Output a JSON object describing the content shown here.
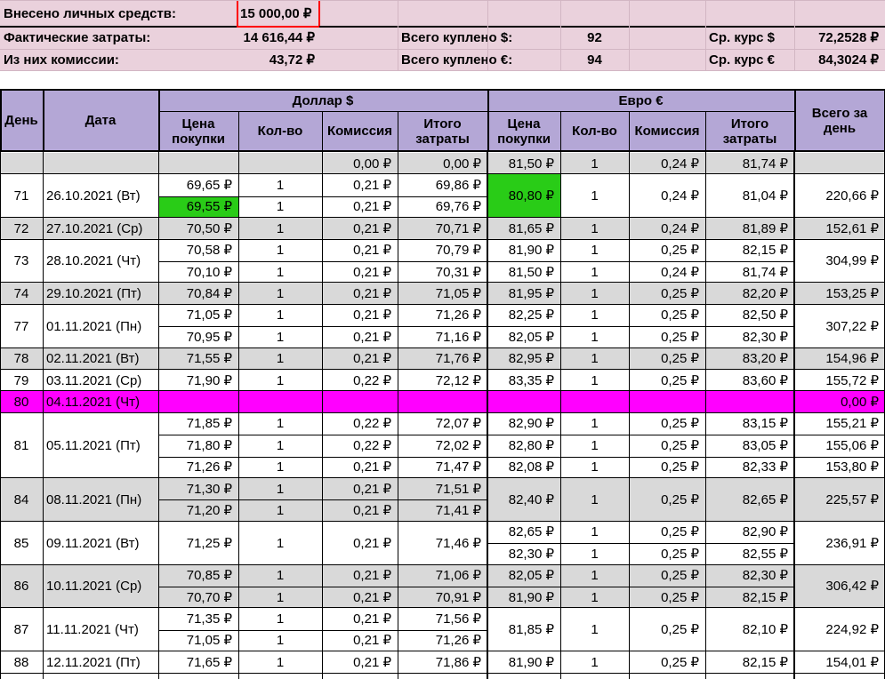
{
  "colors": {
    "summary_bg": "#ead1dc",
    "header_bg": "#b4a7d6",
    "gray_row": "#d9d9d9",
    "holiday": "#ff00ff",
    "highlight_green": "#29cc17",
    "accent_red": "#ff0000"
  },
  "summary": {
    "deposited_label": "Внесено личных средств:",
    "deposited_value": "15 000,00 ₽",
    "actual_label": "Фактические затраты:",
    "actual_value": "14 616,44 ₽",
    "commission_label": "Из них комиссии:",
    "commission_value": "43,72 ₽",
    "usd_bought_label": "Всего куплено $:",
    "usd_bought_value": "92",
    "eur_bought_label": "Всего куплено €:",
    "eur_bought_value": "94",
    "usd_rate_label": "Ср. курс $",
    "usd_rate_value": "72,2528 ₽",
    "eur_rate_label": "Ср. курс €",
    "eur_rate_value": "84,3024 ₽"
  },
  "header": {
    "day": "День",
    "date": "Дата",
    "usd_group": "Доллар $",
    "eur_group": "Евро €",
    "price": "Цена покупки",
    "qty": "Кол-во",
    "commission": "Комиссия",
    "total": "Итого затраты",
    "day_total": "Всего за день"
  },
  "groups": [
    {
      "day": "",
      "date": "",
      "total": "",
      "bg": "gray",
      "rows": 1,
      "usd": [
        {
          "price": "",
          "qty": "",
          "com": "0,00 ₽",
          "tot": "0,00 ₽"
        }
      ],
      "eur": [
        {
          "price": "81,50 ₽",
          "qty": "1",
          "com": "0,24 ₽",
          "tot": "81,74 ₽"
        }
      ]
    },
    {
      "day": "71",
      "date": "26.10.2021 (Вт)",
      "total": "220,66 ₽",
      "bg": "white",
      "rows": 2,
      "usd": [
        {
          "price": "69,65 ₽",
          "qty": "1",
          "com": "0,21 ₽",
          "tot": "69,86 ₽"
        },
        {
          "price": "69,55 ₽",
          "qty": "1",
          "com": "0,21 ₽",
          "tot": "69,76 ₽",
          "green": true
        }
      ],
      "eur": [
        {
          "price": "80,80 ₽",
          "qty": "1",
          "com": "0,24 ₽",
          "tot": "81,04 ₽",
          "green": true
        }
      ]
    },
    {
      "day": "72",
      "date": "27.10.2021 (Ср)",
      "total": "152,61 ₽",
      "bg": "gray",
      "rows": 1,
      "usd": [
        {
          "price": "70,50 ₽",
          "qty": "1",
          "com": "0,21 ₽",
          "tot": "70,71 ₽"
        }
      ],
      "eur": [
        {
          "price": "81,65 ₽",
          "qty": "1",
          "com": "0,24 ₽",
          "tot": "81,89 ₽"
        }
      ]
    },
    {
      "day": "73",
      "date": "28.10.2021 (Чт)",
      "total": "304,99 ₽",
      "bg": "white",
      "rows": 2,
      "usd": [
        {
          "price": "70,58 ₽",
          "qty": "1",
          "com": "0,21 ₽",
          "tot": "70,79 ₽"
        },
        {
          "price": "70,10 ₽",
          "qty": "1",
          "com": "0,21 ₽",
          "tot": "70,31 ₽"
        }
      ],
      "eur": [
        {
          "price": "81,90 ₽",
          "qty": "1",
          "com": "0,25 ₽",
          "tot": "82,15 ₽"
        },
        {
          "price": "81,50 ₽",
          "qty": "1",
          "com": "0,24 ₽",
          "tot": "81,74 ₽"
        }
      ]
    },
    {
      "day": "74",
      "date": "29.10.2021 (Пт)",
      "total": "153,25 ₽",
      "bg": "gray",
      "rows": 1,
      "usd": [
        {
          "price": "70,84 ₽",
          "qty": "1",
          "com": "0,21 ₽",
          "tot": "71,05 ₽"
        }
      ],
      "eur": [
        {
          "price": "81,95 ₽",
          "qty": "1",
          "com": "0,25 ₽",
          "tot": "82,20 ₽"
        }
      ]
    },
    {
      "day": "77",
      "date": "01.11.2021 (Пн)",
      "total": "307,22 ₽",
      "bg": "white",
      "rows": 2,
      "usd": [
        {
          "price": "71,05 ₽",
          "qty": "1",
          "com": "0,21 ₽",
          "tot": "71,26 ₽"
        },
        {
          "price": "70,95 ₽",
          "qty": "1",
          "com": "0,21 ₽",
          "tot": "71,16 ₽"
        }
      ],
      "eur": [
        {
          "price": "82,25 ₽",
          "qty": "1",
          "com": "0,25 ₽",
          "tot": "82,50 ₽"
        },
        {
          "price": "82,05 ₽",
          "qty": "1",
          "com": "0,25 ₽",
          "tot": "82,30 ₽"
        }
      ]
    },
    {
      "day": "78",
      "date": "02.11.2021 (Вт)",
      "total": "154,96 ₽",
      "bg": "gray",
      "rows": 1,
      "usd": [
        {
          "price": "71,55 ₽",
          "qty": "1",
          "com": "0,21 ₽",
          "tot": "71,76 ₽"
        }
      ],
      "eur": [
        {
          "price": "82,95 ₽",
          "qty": "1",
          "com": "0,25 ₽",
          "tot": "83,20 ₽"
        }
      ]
    },
    {
      "day": "79",
      "date": "03.11.2021 (Ср)",
      "total": "155,72 ₽",
      "bg": "white",
      "rows": 1,
      "usd": [
        {
          "price": "71,90 ₽",
          "qty": "1",
          "com": "0,22 ₽",
          "tot": "72,12 ₽"
        }
      ],
      "eur": [
        {
          "price": "83,35 ₽",
          "qty": "1",
          "com": "0,25 ₽",
          "tot": "83,60 ₽"
        }
      ]
    },
    {
      "day": "80",
      "date": "04.11.2021 (Чт)",
      "total": "0,00 ₽",
      "bg": "holiday",
      "rows": 1,
      "usd": [
        {
          "price": "",
          "qty": "",
          "com": "",
          "tot": ""
        }
      ],
      "eur": [
        {
          "price": "",
          "qty": "",
          "com": "",
          "tot": ""
        }
      ]
    },
    {
      "day": "81",
      "date": "05.11.2021 (Пт)",
      "bg": "white",
      "rows": 3,
      "split_total": true,
      "totals": [
        "155,21 ₽",
        "155,06 ₽",
        "153,80 ₽"
      ],
      "usd": [
        {
          "price": "71,85 ₽",
          "qty": "1",
          "com": "0,22 ₽",
          "tot": "72,07 ₽"
        },
        {
          "price": "71,80 ₽",
          "qty": "1",
          "com": "0,22 ₽",
          "tot": "72,02 ₽"
        },
        {
          "price": "71,26 ₽",
          "qty": "1",
          "com": "0,21 ₽",
          "tot": "71,47 ₽"
        }
      ],
      "eur": [
        {
          "price": "82,90 ₽",
          "qty": "1",
          "com": "0,25 ₽",
          "tot": "83,15 ₽"
        },
        {
          "price": "82,80 ₽",
          "qty": "1",
          "com": "0,25 ₽",
          "tot": "83,05 ₽"
        },
        {
          "price": "82,08 ₽",
          "qty": "1",
          "com": "0,25 ₽",
          "tot": "82,33 ₽"
        }
      ]
    },
    {
      "day": "84",
      "date": "08.11.2021 (Пн)",
      "total": "225,57 ₽",
      "bg": "gray",
      "rows": 2,
      "usd": [
        {
          "price": "71,30 ₽",
          "qty": "1",
          "com": "0,21 ₽",
          "tot": "71,51 ₽"
        },
        {
          "price": "71,20 ₽",
          "qty": "1",
          "com": "0,21 ₽",
          "tot": "71,41 ₽"
        }
      ],
      "eur": [
        {
          "price": "82,40 ₽",
          "qty": "1",
          "com": "0,25 ₽",
          "tot": "82,65 ₽"
        }
      ]
    },
    {
      "day": "85",
      "date": "09.11.2021 (Вт)",
      "total": "236,91 ₽",
      "bg": "white",
      "rows": 2,
      "usd": [
        {
          "price": "71,25 ₽",
          "qty": "1",
          "com": "0,21 ₽",
          "tot": "71,46 ₽"
        }
      ],
      "eur": [
        {
          "price": "82,65 ₽",
          "qty": "1",
          "com": "0,25 ₽",
          "tot": "82,90 ₽"
        },
        {
          "price": "82,30 ₽",
          "qty": "1",
          "com": "0,25 ₽",
          "tot": "82,55 ₽"
        }
      ]
    },
    {
      "day": "86",
      "date": "10.11.2021 (Ср)",
      "total": "306,42 ₽",
      "bg": "gray",
      "rows": 2,
      "usd": [
        {
          "price": "70,85 ₽",
          "qty": "1",
          "com": "0,21 ₽",
          "tot": "71,06 ₽"
        },
        {
          "price": "70,70 ₽",
          "qty": "1",
          "com": "0,21 ₽",
          "tot": "70,91 ₽"
        }
      ],
      "eur": [
        {
          "price": "82,05 ₽",
          "qty": "1",
          "com": "0,25 ₽",
          "tot": "82,30 ₽"
        },
        {
          "price": "81,90 ₽",
          "qty": "1",
          "com": "0,25 ₽",
          "tot": "82,15 ₽"
        }
      ]
    },
    {
      "day": "87",
      "date": "11.11.2021 (Чт)",
      "total": "224,92 ₽",
      "bg": "white",
      "rows": 2,
      "usd": [
        {
          "price": "71,35 ₽",
          "qty": "1",
          "com": "0,21 ₽",
          "tot": "71,56 ₽"
        },
        {
          "price": "71,05 ₽",
          "qty": "1",
          "com": "0,21 ₽",
          "tot": "71,26 ₽"
        }
      ],
      "eur": [
        {
          "price": "81,85 ₽",
          "qty": "1",
          "com": "0,25 ₽",
          "tot": "82,10 ₽"
        }
      ]
    },
    {
      "day": "88",
      "date": "12.11.2021 (Пт)",
      "total": "154,01 ₽",
      "bg": "white",
      "rows": 1,
      "usd": [
        {
          "price": "71,65 ₽",
          "qty": "1",
          "com": "0,21 ₽",
          "tot": "71,86 ₽"
        }
      ],
      "eur": [
        {
          "price": "81,90 ₽",
          "qty": "1",
          "com": "0,25 ₽",
          "tot": "82,15 ₽"
        }
      ]
    }
  ]
}
